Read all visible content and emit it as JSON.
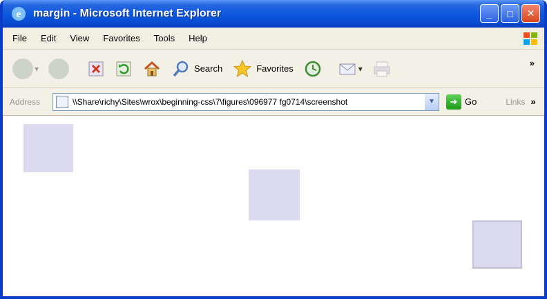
{
  "window": {
    "title": "margin - Microsoft Internet Explorer",
    "caption_buttons": {
      "minimize": "_",
      "maximize": "□",
      "close": "✕"
    }
  },
  "menu": [
    "File",
    "Edit",
    "View",
    "Favorites",
    "Tools",
    "Help"
  ],
  "toolbar": {
    "back_icon": "back-arrow-icon",
    "forward_icon": "forward-arrow-icon",
    "stop_icon": "stop-icon",
    "refresh_icon": "refresh-icon",
    "home_icon": "home-icon",
    "search_label": "Search",
    "favorites_label": "Favorites",
    "history_icon": "history-icon",
    "mail_icon": "mail-icon",
    "print_icon": "print-icon",
    "overflow": "»"
  },
  "address": {
    "label": "Address",
    "value": "\\\\Share\\richy\\Sites\\wrox\\beginning-css\\7\\figures\\096977 fg0714\\screenshot",
    "go_label": "Go",
    "links_label": "Links",
    "overflow": "»"
  },
  "colors": {
    "title_bar": "#0b57dd",
    "chrome": "#ece9d8",
    "box_fill": "#dcdaee"
  }
}
